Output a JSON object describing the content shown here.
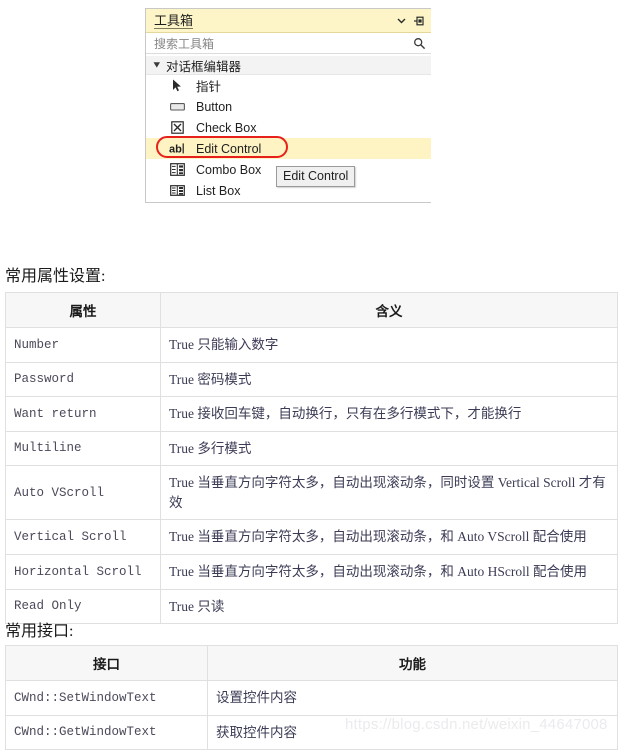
{
  "toolbox": {
    "title": "工具箱",
    "window_controls": [
      {
        "name": "chevron-down-icon",
        "label": "▾"
      },
      {
        "name": "pin-icon",
        "label": "pin"
      }
    ],
    "search": {
      "placeholder": "搜索工具箱",
      "value": "",
      "icon": "search-icon"
    },
    "group": {
      "label": "对话框编辑器",
      "expanded": true,
      "triangle_icon": "triangle-down-icon"
    },
    "items": [
      {
        "label": "指针",
        "icon": "pointer-icon",
        "selected": false
      },
      {
        "label": "Button",
        "icon": "button-icon",
        "selected": false
      },
      {
        "label": "Check Box",
        "icon": "checkbox-icon",
        "selected": false
      },
      {
        "label": "Edit Control",
        "icon": "edit-control-icon",
        "selected": true
      },
      {
        "label": "Combo Box",
        "icon": "combobox-icon",
        "selected": false
      },
      {
        "label": "List Box",
        "icon": "listbox-icon",
        "selected": false
      }
    ],
    "tooltip": "Edit Control",
    "highlight_color": "#e8201a",
    "selection_color": "#fdf3c3",
    "titlebar_color": "#fdf5c8"
  },
  "properties_section": {
    "heading": "常用属性设置:",
    "columns": [
      "属性",
      "含义"
    ],
    "rows": [
      {
        "key": "Number",
        "value": "True 只能输入数字"
      },
      {
        "key": "Password",
        "value": "True 密码模式"
      },
      {
        "key": "Want return",
        "value": "True 接收回车键，自动换行，只有在多行模式下，才能换行"
      },
      {
        "key": "Multiline",
        "value": "True 多行模式"
      },
      {
        "key": "Auto VScroll",
        "value": "True 当垂直方向字符太多，自动出现滚动条，同时设置 Vertical Scroll 才有效"
      },
      {
        "key": "Vertical Scroll",
        "value": "True 当垂直方向字符太多，自动出现滚动条，和 Auto VScroll 配合使用"
      },
      {
        "key": "Horizontal Scroll",
        "value": "True 当垂直方向字符太多，自动出现滚动条，和 Auto HScroll 配合使用"
      },
      {
        "key": "Read Only",
        "value": "True 只读"
      }
    ]
  },
  "interface_section": {
    "heading": "常用接口:",
    "columns": [
      "接口",
      "功能"
    ],
    "rows": [
      {
        "key": "CWnd::SetWindowText",
        "value": "设置控件内容"
      },
      {
        "key": "CWnd::GetWindowText",
        "value": "获取控件内容"
      }
    ]
  },
  "watermark": "https://blog.csdn.net/weixin_44647008"
}
